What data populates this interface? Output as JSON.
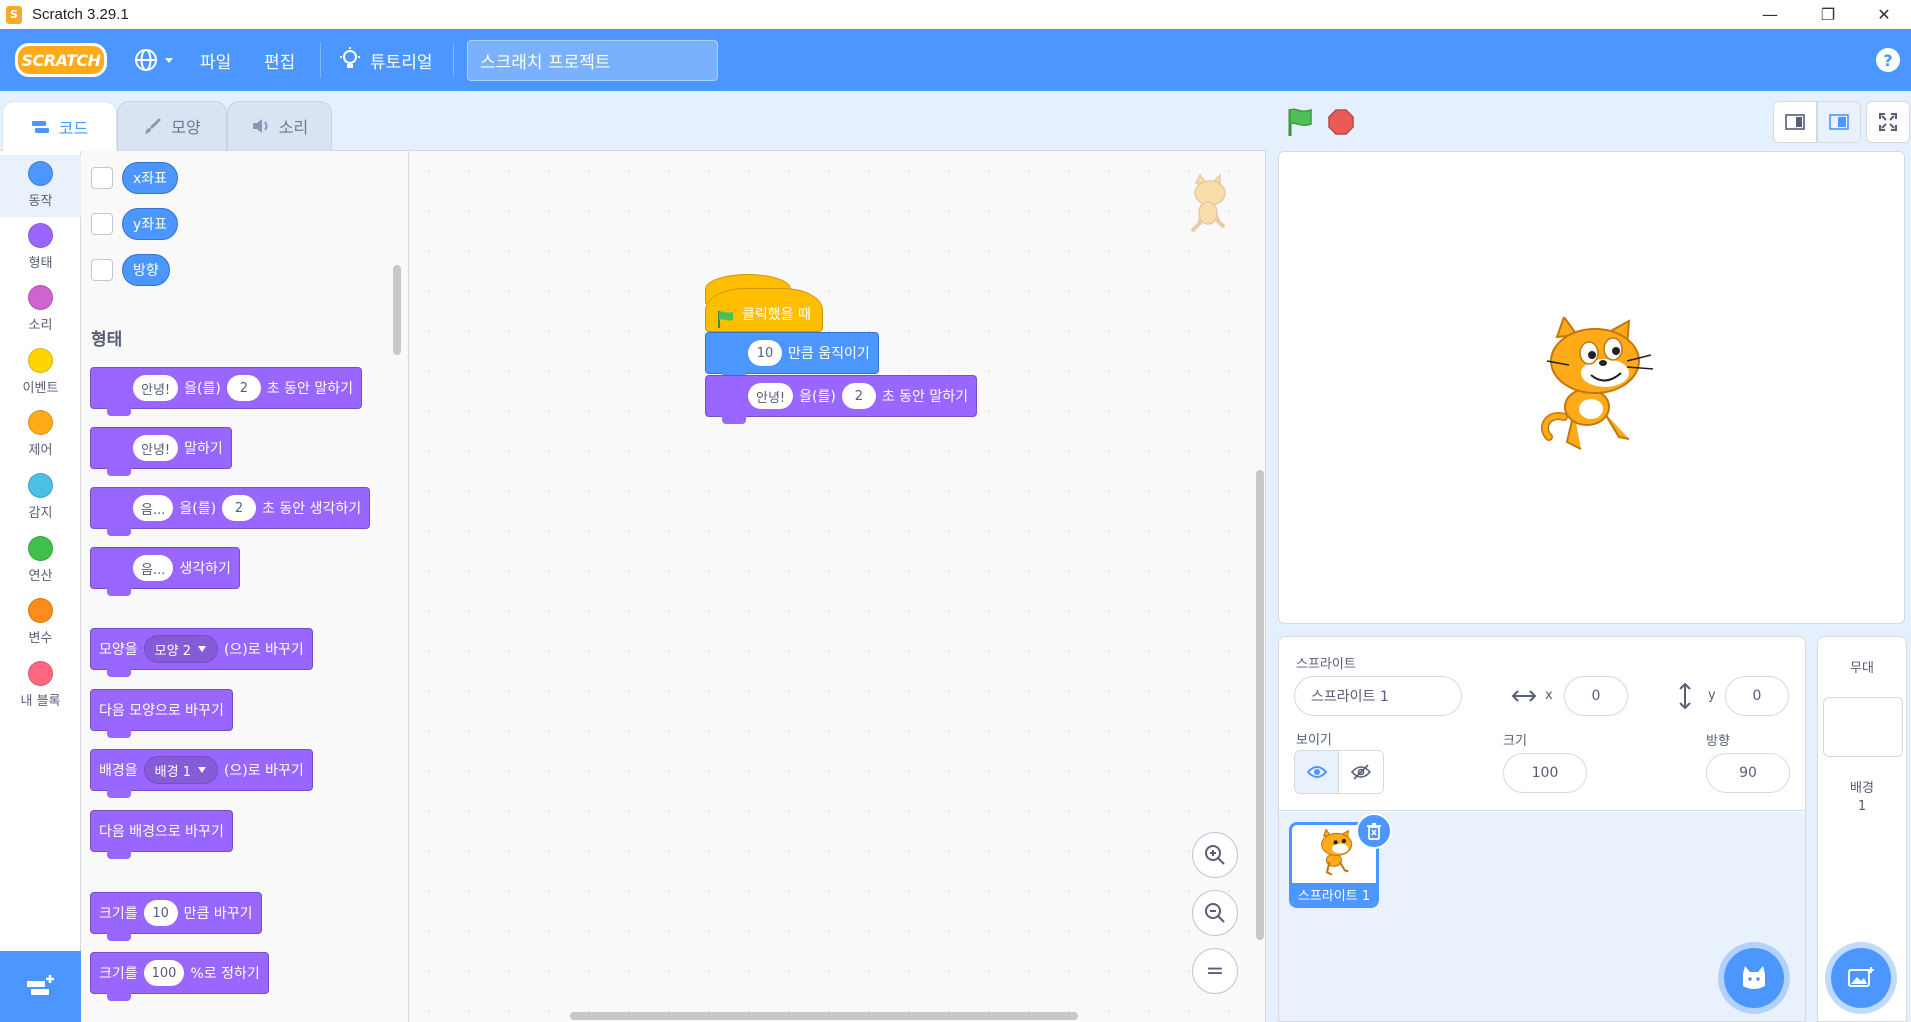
{
  "window": {
    "title": "Scratch 3.29.1",
    "minimize_glyph": "—",
    "restore_glyph": "❐",
    "close_glyph": "✕"
  },
  "menubar": {
    "logo_text": "SCRATCH",
    "language_icon": "globe-icon",
    "file": "파일",
    "edit": "편집",
    "tutorials": "튜토리얼",
    "project_title": "스크래치 프로젝트",
    "help": "?"
  },
  "tabs": [
    {
      "label": "코드",
      "icon": "code-icon",
      "active": true
    },
    {
      "label": "모양",
      "icon": "brush-icon",
      "active": false
    },
    {
      "label": "소리",
      "icon": "speaker-icon",
      "active": false
    }
  ],
  "categories": [
    {
      "label": "동작",
      "color": "#4c97ff"
    },
    {
      "label": "형태",
      "color": "#9966ff"
    },
    {
      "label": "소리",
      "color": "#cf63cf"
    },
    {
      "label": "이벤트",
      "color": "#ffd500"
    },
    {
      "label": "제어",
      "color": "#ffab19"
    },
    {
      "label": "감지",
      "color": "#4cbfe6"
    },
    {
      "label": "연산",
      "color": "#40bf4a"
    },
    {
      "label": "변수",
      "color": "#ff8c1a"
    },
    {
      "label": "내 블록",
      "color": "#ff6680"
    }
  ],
  "palette": {
    "reporters": [
      "x좌표",
      "y좌표",
      "방향"
    ],
    "looks_title": "형태",
    "say_for": {
      "text": "안녕!",
      "mid": "을(를)",
      "secs": "2",
      "end": "초 동안 말하기"
    },
    "say": {
      "text": "안녕!",
      "end": "말하기"
    },
    "think_for": {
      "text": "음...",
      "mid": "을(를)",
      "secs": "2",
      "end": "초 동안 생각하기"
    },
    "think": {
      "text": "음...",
      "end": "생각하기"
    },
    "switch_costume": {
      "start": "모양을",
      "value": "모양 2",
      "end": "(으)로 바꾸기"
    },
    "next_costume": "다음 모양으로 바꾸기",
    "switch_backdrop": {
      "start": "배경을",
      "value": "배경 1",
      "end": "(으)로 바꾸기"
    },
    "next_backdrop": "다음 배경으로 바꾸기",
    "change_size": {
      "start": "크기를",
      "value": "10",
      "end": "만큼 바꾸기"
    },
    "set_size": {
      "start": "크기를",
      "value": "100",
      "end": "%로 정하기"
    }
  },
  "script": {
    "hat": "클릭했을 때",
    "move": {
      "value": "10",
      "end": "만큼 움직이기"
    },
    "say_for": {
      "text": "안녕!",
      "mid": "을(를)",
      "secs": "2",
      "end": "초 동안 말하기"
    }
  },
  "zoom": {
    "zoom_in": "+",
    "zoom_out": "−",
    "reset": "="
  },
  "sprite_info": {
    "sprite_label": "스프라이트",
    "sprite_name": "스프라이트 1",
    "x_label": "x",
    "x_value": "0",
    "y_label": "y",
    "y_value": "0",
    "show_label": "보이기",
    "size_label": "크기",
    "size_value": "100",
    "direction_label": "방향",
    "direction_value": "90"
  },
  "sprites": [
    {
      "name": "스프라이트 1",
      "selected": true
    }
  ],
  "stage_pane": {
    "title": "무대",
    "backdrop_label": "배경",
    "backdrop_count": "1"
  },
  "colors": {
    "primary": "#4c97ff",
    "looks": "#9966ff",
    "events": "#ffbf00",
    "motion": "#4c97ff"
  }
}
